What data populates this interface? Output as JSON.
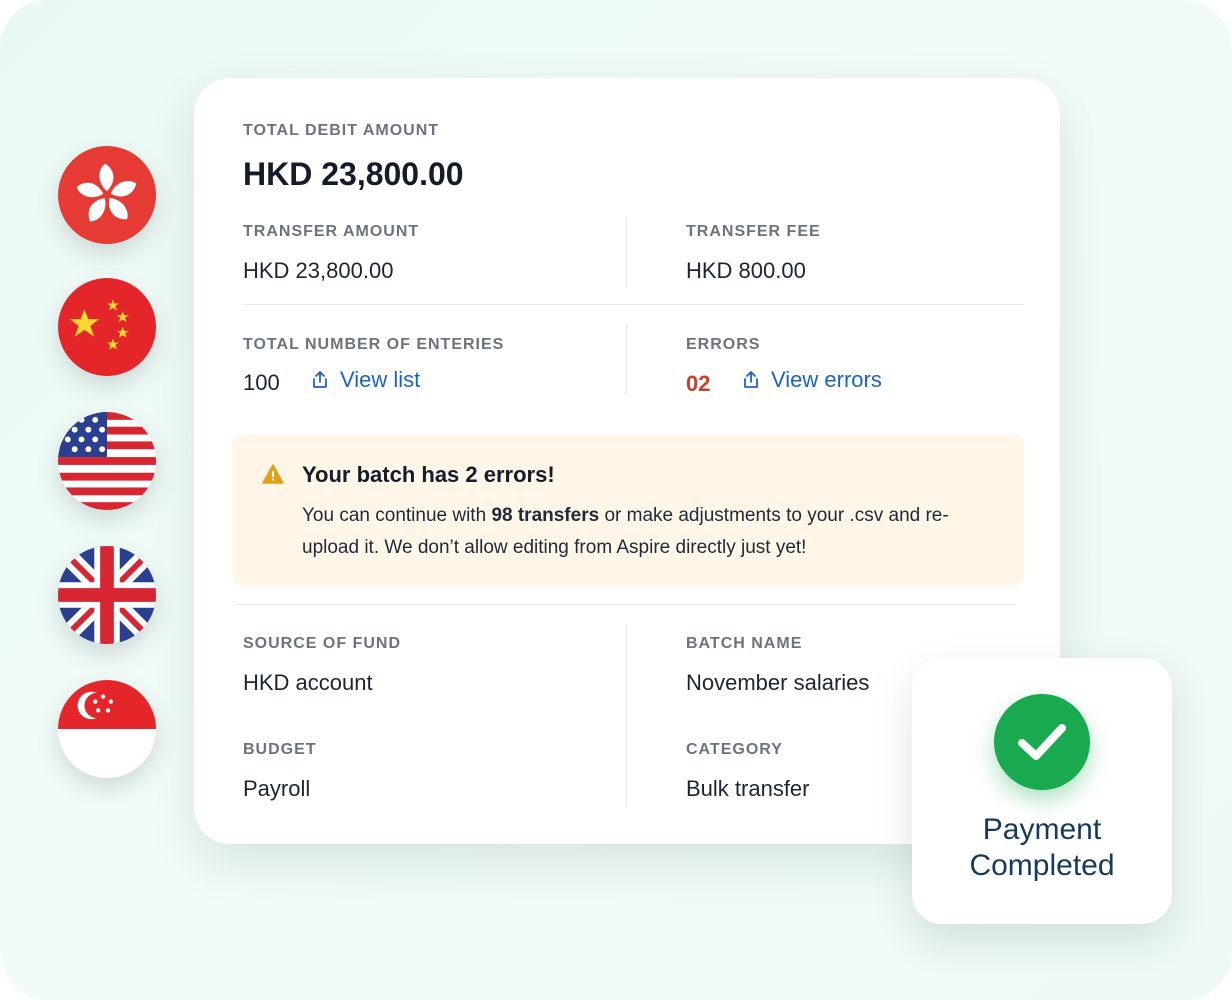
{
  "summary": {
    "total_debit_label": "TOTAL DEBIT AMOUNT",
    "total_debit_value": "HKD 23,800.00",
    "transfer_amount_label": "TRANSFER AMOUNT",
    "transfer_amount_value": "HKD 23,800.00",
    "transfer_fee_label": "TRANSFER FEE",
    "transfer_fee_value": "HKD 800.00",
    "entries_label": "TOTAL NUMBER OF ENTERIES",
    "entries_value": "100",
    "view_list_label": "View list",
    "errors_label": "ERRORS",
    "errors_value": "02",
    "view_errors_label": "View errors"
  },
  "alert": {
    "title": "Your batch has 2 errors!",
    "body_prefix": "You can continue with ",
    "body_bold": "98 transfers",
    "body_suffix": " or make adjustments to your .csv and re-upload it. We don’t allow editing from Aspire directly just yet!"
  },
  "details": {
    "source_label": "SOURCE OF FUND",
    "source_value": "HKD account",
    "batch_label": "BATCH NAME",
    "batch_value": "November salaries",
    "budget_label": "BUDGET",
    "budget_value": "Payroll",
    "category_label": "CATEGORY",
    "category_value": "Bulk transfer"
  },
  "payment_status": {
    "line1": "Payment",
    "line2": "Completed"
  },
  "flags": [
    "hong-kong",
    "china",
    "united-states",
    "united-kingdom",
    "singapore"
  ],
  "colors": {
    "link": "#1b64c4",
    "error": "#c8402a",
    "alert_bg": "#fff6e8",
    "success": "#19a94f"
  }
}
